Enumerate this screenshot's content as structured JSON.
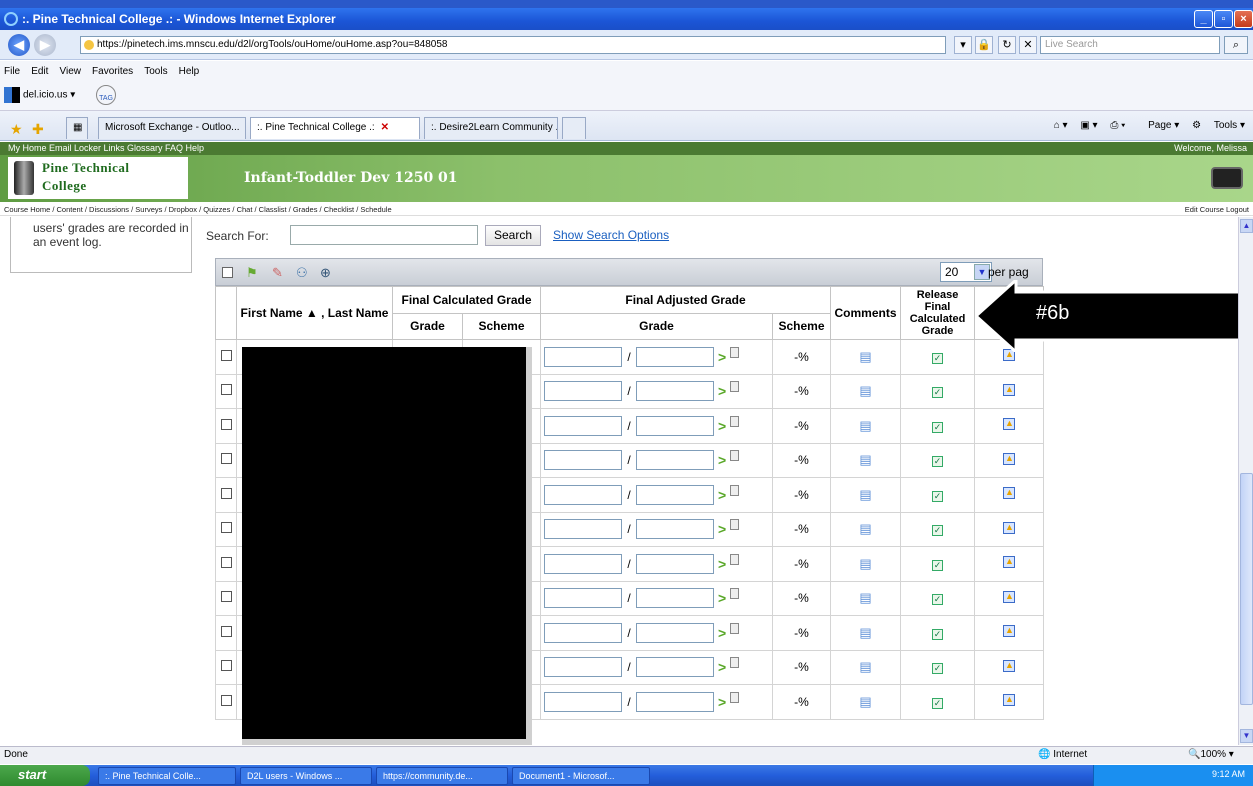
{
  "window": {
    "title": ":. Pine Technical College .: - Windows Internet Explorer"
  },
  "address": {
    "url": "https://pinetech.ims.mnscu.edu/d2l/orgTools/ouHome/ouHome.asp?ou=848058",
    "search_placeholder": "Live Search"
  },
  "menu": [
    "File",
    "Edit",
    "View",
    "Favorites",
    "Tools",
    "Help"
  ],
  "favorites": {
    "delicious": "del.icio.us",
    "tag": "TAG"
  },
  "tabs": [
    {
      "label": "Microsoft Exchange - Outloo..."
    },
    {
      "label": ":. Pine Technical College .:",
      "active": true
    },
    {
      "label": ":. Desire2Learn Community .:"
    }
  ],
  "commands": {
    "page": "Page",
    "tools": "Tools"
  },
  "d2l": {
    "topnav": "My Home  Email  Locker  Links  Glossary  FAQ  Help",
    "welcome": "Welcome, Melissa",
    "logo_line1": "Pine Technical",
    "logo_line2": "College",
    "course": "Infant-Toddler Dev 1250 01",
    "tools_nav": "Course Home / Content / Discussions / Surveys / Dropbox / Quizzes / Chat / Classlist / Grades / Checklist / Schedule",
    "edit_course": "Edit Course  Logout"
  },
  "sidebar": {
    "text": "users' grades are recorded in an event log."
  },
  "search": {
    "label": "Search For:",
    "button": "Search",
    "options": "Show Search Options"
  },
  "grid": {
    "per_page": "20",
    "per_page_label": "per pag",
    "headers": {
      "name": "First Name ▲ , Last Name",
      "final_calc": "Final Calculated Grade",
      "final_adj": "Final Adjusted Grade",
      "comments": "Comments",
      "release": "Release Final Calculated Grade",
      "grade": "Grade",
      "scheme": "Scheme"
    },
    "scheme_value": "-%",
    "row_count": 11
  },
  "callout": {
    "label": "#6b"
  },
  "status": {
    "left": "Done",
    "zone": "Internet",
    "zoom": "100%"
  },
  "taskbar": {
    "start": "start",
    "buttons": [
      ":. Pine Technical Colle...",
      "D2L users - Windows ...",
      "https://community.de...",
      "Document1 - Microsof..."
    ],
    "clock": "9:12 AM"
  },
  "colors": {
    "d2l_green": "#4b7a32",
    "callout": "#000000",
    "link": "#1a5fc0"
  }
}
